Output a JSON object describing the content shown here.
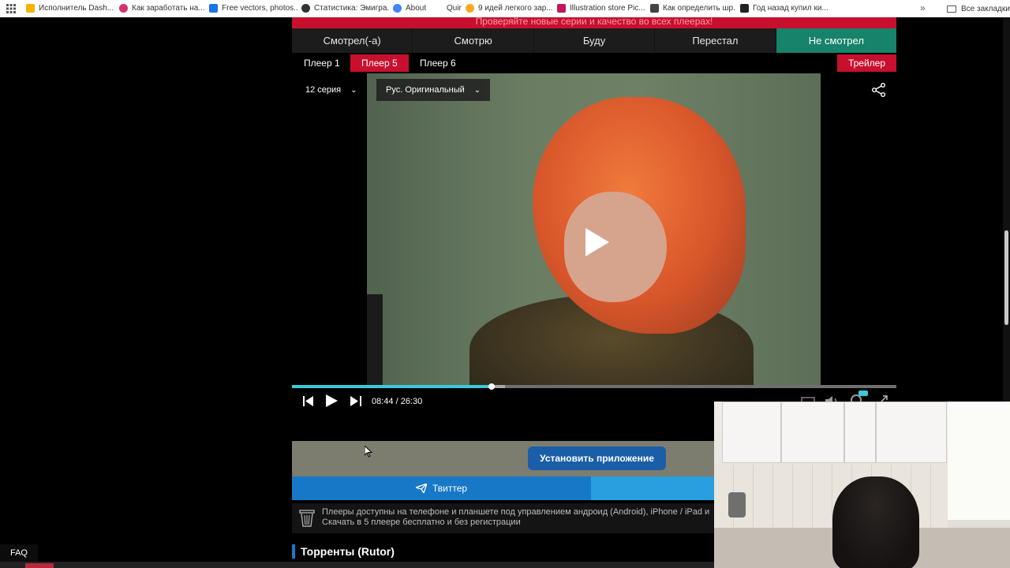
{
  "bookmarks": {
    "items": [
      {
        "label": "Исполнитель Dash...",
        "color": "#f4b400"
      },
      {
        "label": "Как заработать на...",
        "color": "#d6336c"
      },
      {
        "label": "Free vectors, photos...",
        "color": "#1a73e8"
      },
      {
        "label": "Статистика: Эмигра...",
        "color": "#333333"
      },
      {
        "label": "About",
        "color": "#4285f4"
      },
      {
        "label": "Quirky",
        "color": "#ffffff"
      },
      {
        "label": "9 идей легкого зар...",
        "color": "#f9a825"
      },
      {
        "label": "Illustration store Pic...",
        "color": "#c2185b"
      },
      {
        "label": "Как определить шр...",
        "color": "#444444"
      },
      {
        "label": "Год назад купил ки...",
        "color": "#222222"
      }
    ],
    "more": "»",
    "all_bookmarks": "Все закладки"
  },
  "banner": "Проверяйте новые серии и качество во всех плеерах!",
  "status_tabs": [
    {
      "label": "Смотрел(-а)",
      "active": false
    },
    {
      "label": "Смотрю",
      "active": false
    },
    {
      "label": "Буду",
      "active": false
    },
    {
      "label": "Перестал",
      "active": false
    },
    {
      "label": "Не смотрел",
      "active": true
    }
  ],
  "player_tabs": [
    {
      "label": "Плеер 1",
      "active": false
    },
    {
      "label": "Плеер 5",
      "active": true
    },
    {
      "label": "Плеер 6",
      "active": false
    }
  ],
  "trailer_label": "Трейлер",
  "video": {
    "episode": "12 серия",
    "audio": "Рус. Оригинальный",
    "time": "08:44 / 26:30",
    "progress": 0.33
  },
  "install_label": "Установить приложение",
  "twitter_label": "Твиттер",
  "info_lines": [
    "Плееры доступны на телефоне и планшете под управлением андроид (Android), iPhone / iPad и",
    "Скачать в 5 плеере бесплатно и без регистрации"
  ],
  "torrents_title": "Торренты (Rutor)",
  "faq_label": "FAQ",
  "colors": {
    "accent_red": "#c8102e",
    "active_green": "#16836a",
    "progress_cyan": "#3bc9d9",
    "button_blue": "#1a5ea8"
  }
}
